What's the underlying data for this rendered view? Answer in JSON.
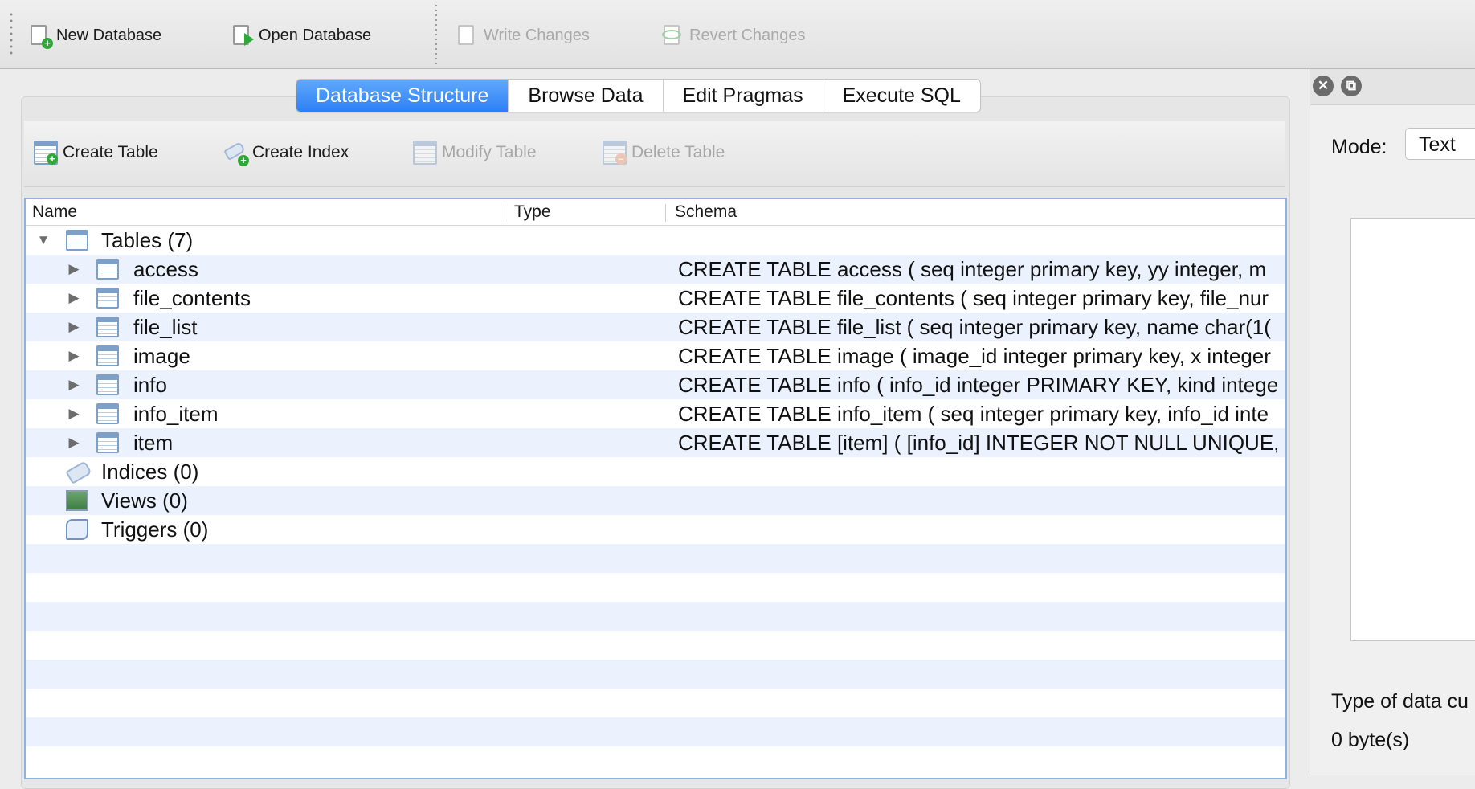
{
  "toolbar": {
    "new_db": "New Database",
    "open_db": "Open Database",
    "write": "Write Changes",
    "revert": "Revert Changes"
  },
  "tabs": [
    "Database Structure",
    "Browse Data",
    "Edit Pragmas",
    "Execute SQL"
  ],
  "active_tab": "Database Structure",
  "structure_toolbar": {
    "create_table": "Create Table",
    "create_index": "Create Index",
    "modify_table": "Modify Table",
    "delete_table": "Delete Table"
  },
  "tree": {
    "columns": [
      "Name",
      "Type",
      "Schema"
    ],
    "tables_label": "Tables (7)",
    "tables": [
      {
        "name": "access",
        "schema": "CREATE TABLE access ( seq integer primary key, yy integer, m"
      },
      {
        "name": "file_contents",
        "schema": "CREATE TABLE file_contents ( seq integer primary key, file_nur"
      },
      {
        "name": "file_list",
        "schema": "CREATE TABLE file_list ( seq integer primary key, name char(1("
      },
      {
        "name": "image",
        "schema": "CREATE TABLE image ( image_id integer primary key, x integer"
      },
      {
        "name": "info",
        "schema": "CREATE TABLE info ( info_id integer PRIMARY KEY, kind intege"
      },
      {
        "name": "info_item",
        "schema": "CREATE TABLE info_item ( seq integer primary key, info_id inte"
      },
      {
        "name": "item",
        "schema": "CREATE TABLE [item] ( [info_id] INTEGER NOT NULL UNIQUE,"
      }
    ],
    "indices_label": "Indices (0)",
    "views_label": "Views (0)",
    "triggers_label": "Triggers (0)"
  },
  "edit_cell": {
    "mode_label": "Mode:",
    "mode_value": "Text",
    "type_label": "Type of data cu",
    "size_label": "0 byte(s)"
  },
  "colors": {
    "accent": "#2d7ff7",
    "row_alt": "#ebf2fd",
    "tree_border": "#8fb2e2"
  }
}
